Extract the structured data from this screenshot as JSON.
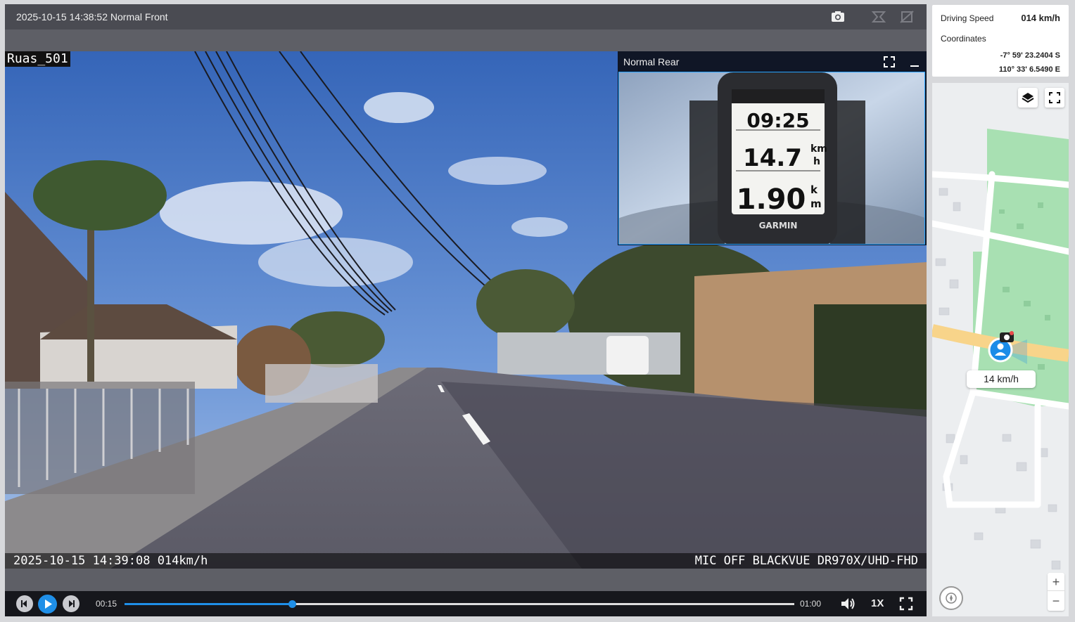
{
  "player": {
    "title": "2025-10-15 14:38:52 Normal Front",
    "toolbar_icons": [
      "camera-icon",
      "dual-view-icon",
      "hide-view-icon"
    ]
  },
  "front": {
    "channel_name": "Ruas_501",
    "osd_time": "2025-10-15 14:39:08 014km/h",
    "osd_camera": "MIC OFF BLACKVUE DR970X/UHD-FHD"
  },
  "rear": {
    "label": "Normal Rear",
    "gps_device": {
      "time": "09:25",
      "speed": "14.7",
      "speed_unit_top": "km",
      "speed_unit_bottom": "h",
      "distance": "1.90",
      "distance_unit_top": "k",
      "distance_unit_bottom": "m",
      "brand": "GARMIN"
    }
  },
  "controls": {
    "current_time": "00:15",
    "end_time": "01:00",
    "progress": 0.25,
    "playback_speed": "1X"
  },
  "info": {
    "speed_label": "Driving Speed",
    "speed_value": "014 km/h",
    "coord_label": "Coordinates",
    "latitude": "-7° 59' 23.2404 S",
    "longitude": "110° 33' 6.5490 E"
  },
  "map": {
    "speed_tag": "14 km/h",
    "zoom_in": "+",
    "zoom_out": "−",
    "colors": {
      "park": "#a8e0b2",
      "road": "#ffffff",
      "main_road": "#f8d48a",
      "marker": "#1a8ce8"
    }
  }
}
